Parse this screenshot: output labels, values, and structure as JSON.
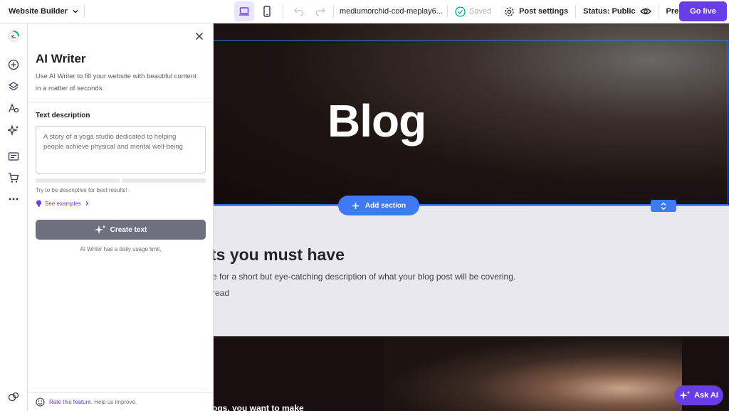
{
  "topbar": {
    "brand": "Website Builder",
    "url": "mediumorchid-cod-meplay6...",
    "saved": "Saved",
    "post_settings": "Post settings",
    "status": "Status: Public",
    "preview": "Preview",
    "go_live": "Go live"
  },
  "panel": {
    "title": "AI Writer",
    "intro": "Use AI Writer to fill your website with beautiful content in a matter of seconds.",
    "text_description_label": "Text description",
    "placeholder": "A story of a yoga studio dedicated to helping people achieve physical and mental well-being",
    "hint": "Try to be descriptive for best results!",
    "see_examples": "See examples",
    "create_button": "Create text",
    "usage_limit": "AI Writer has a daily usage limit.",
    "rate_link": "Rate this feature.",
    "rate_suffix": "Help us improve."
  },
  "canvas": {
    "hero_title": "Blog",
    "add_section": "Add section",
    "section_heading": "ts you must have",
    "section_desc": "e for a short but eye-catching description of what your blog post will be covering.",
    "section_read": "read",
    "bottom_text": "ogs, you want to make"
  },
  "ask_ai": "Ask AI",
  "colors": {
    "accent": "#673de6",
    "selection": "#3e7bf2"
  }
}
